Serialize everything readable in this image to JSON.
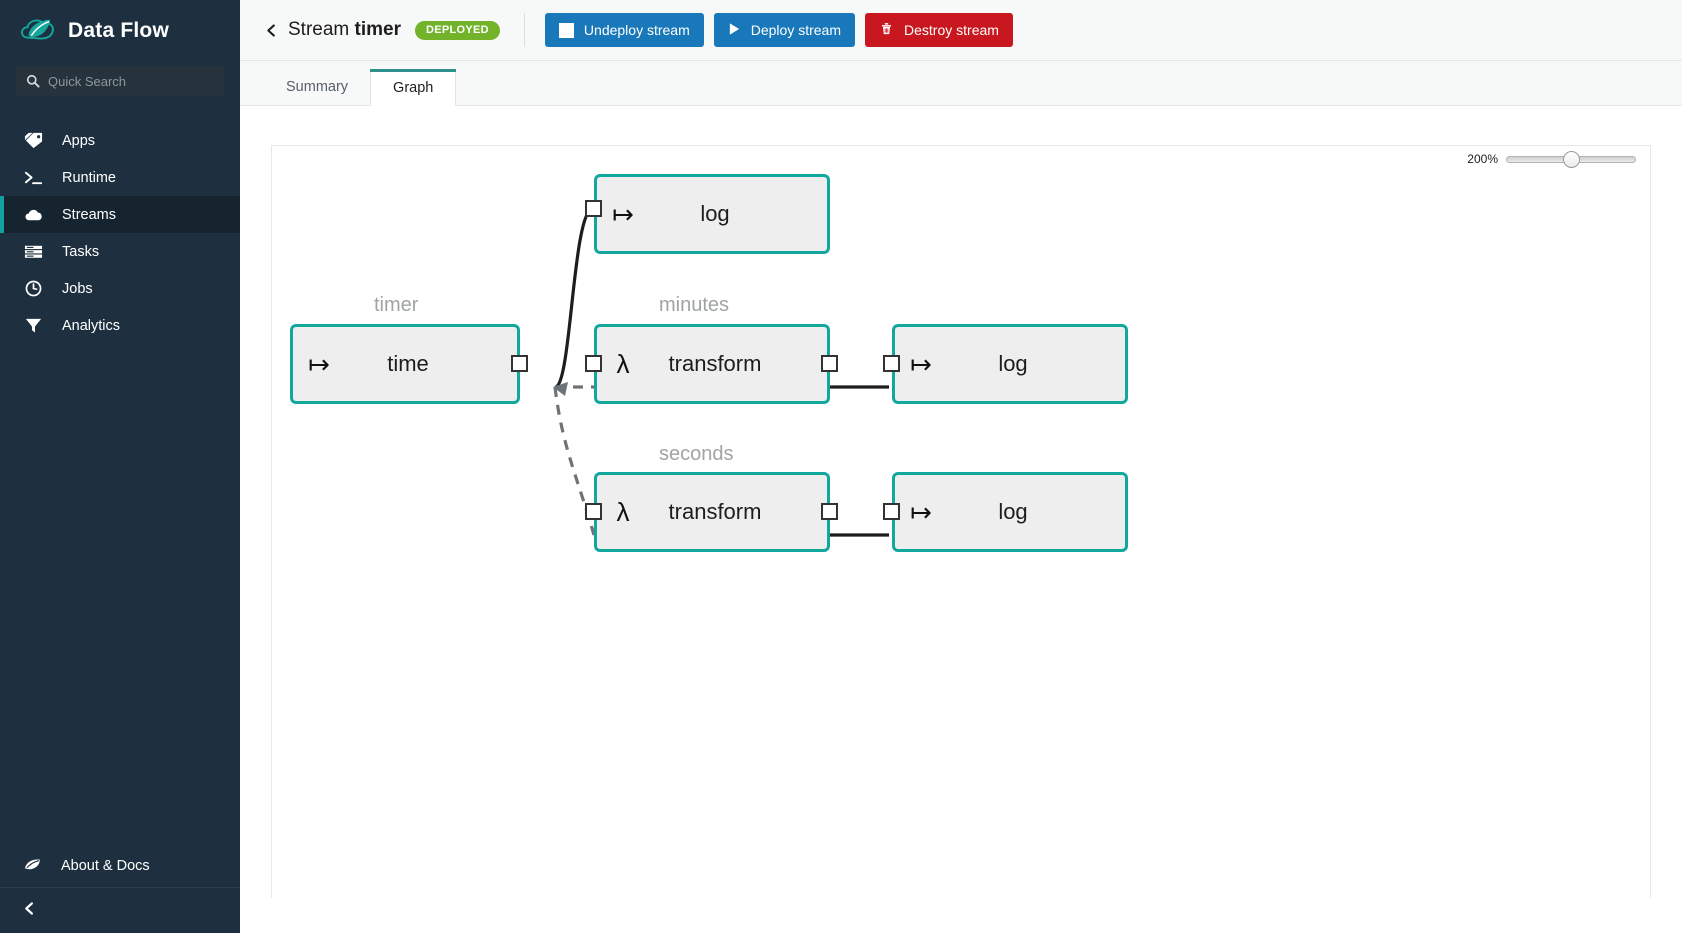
{
  "sidebar": {
    "brand": "Data Flow",
    "logo_icon": "spring-leaf-cloud-icon",
    "search": {
      "placeholder": "Quick Search",
      "value": "",
      "icon": "search-icon"
    },
    "items": [
      {
        "label": "Apps",
        "icon": "tag-icon",
        "active": false
      },
      {
        "label": "Runtime",
        "icon": "terminal-prompt-icon",
        "active": false
      },
      {
        "label": "Streams",
        "icon": "cloud-icon",
        "active": true
      },
      {
        "label": "Tasks",
        "icon": "server-stack-icon",
        "active": false
      },
      {
        "label": "Jobs",
        "icon": "clock-icon",
        "active": false
      },
      {
        "label": "Analytics",
        "icon": "funnel-icon",
        "active": false
      }
    ],
    "about": {
      "label": "About & Docs",
      "icon": "leaf-icon"
    },
    "collapse": {
      "icon": "chevron-left-icon"
    }
  },
  "topbar": {
    "back_icon": "chevron-left-icon",
    "title_prefix": "Stream ",
    "title_name": "timer",
    "status": "DEPLOYED",
    "status_color": "#72b32a",
    "buttons": [
      {
        "label": "Undeploy stream",
        "icon": "stop-square-icon",
        "style": "blue",
        "color": "#1878b9"
      },
      {
        "label": "Deploy stream",
        "icon": "play-triangle-icon",
        "style": "blue",
        "color": "#1878b9"
      },
      {
        "label": "Destroy stream",
        "icon": "trash-icon",
        "style": "red",
        "color": "#c8171e"
      }
    ]
  },
  "tabs": [
    {
      "label": "Summary",
      "active": false
    },
    {
      "label": "Graph",
      "active": true
    }
  ],
  "graph": {
    "zoom_label": "200%",
    "zoom_value": 50,
    "accent_color": "#13a89e",
    "nodes": [
      {
        "id": "time",
        "name": "timer",
        "label": "time",
        "icon": "source-arrow-icon",
        "glyph": "↦"
      },
      {
        "id": "log-top",
        "name": "",
        "label": "log",
        "icon": "sink-arrow-icon",
        "glyph": "↦"
      },
      {
        "id": "tf-minutes",
        "name": "minutes",
        "label": "transform",
        "icon": "lambda-icon",
        "glyph": "λ"
      },
      {
        "id": "log-minutes",
        "name": "",
        "label": "log",
        "icon": "sink-arrow-icon",
        "glyph": "↦"
      },
      {
        "id": "tf-seconds",
        "name": "seconds",
        "label": "transform",
        "icon": "lambda-icon",
        "glyph": "λ"
      },
      {
        "id": "log-seconds",
        "name": "",
        "label": "log",
        "icon": "sink-arrow-icon",
        "glyph": "↦"
      }
    ],
    "edges": [
      {
        "from": "time",
        "to": "log-top",
        "style": "solid"
      },
      {
        "from": "time",
        "to": "tf-minutes",
        "style": "dashed"
      },
      {
        "from": "time",
        "to": "tf-seconds",
        "style": "dashed"
      },
      {
        "from": "tf-minutes",
        "to": "log-minutes",
        "style": "solid"
      },
      {
        "from": "tf-seconds",
        "to": "log-seconds",
        "style": "solid"
      }
    ]
  }
}
